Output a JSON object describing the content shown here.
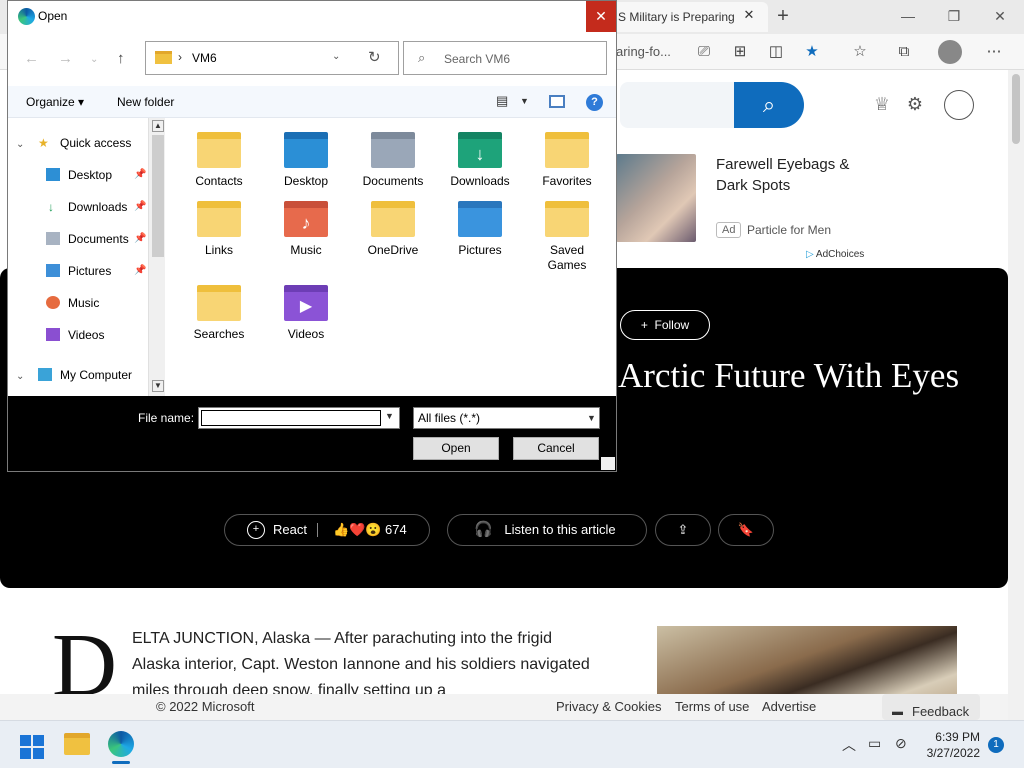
{
  "browser": {
    "tab_title": "S Military is Preparing",
    "tab_close": "✕",
    "new_tab": "+",
    "url": "aring-fo...",
    "controls": {
      "minimize": "—",
      "maximize": "❐",
      "close": "✕"
    },
    "toolbar_icons": [
      "read-aloud-icon",
      "apps-icon",
      "split-screen-icon",
      "favorite-star-icon",
      "favorites-icon",
      "collections-icon",
      "profile-icon",
      "more-icon"
    ]
  },
  "page": {
    "ad": {
      "title": "Farewell Eyebags & Dark Spots",
      "badge": "Ad",
      "sponsor": "Particle for Men",
      "adchoices": "AdChoices"
    },
    "hero": {
      "follow": "Follow",
      "headline": "Arctic Future With Eyes"
    },
    "actions": {
      "react": "React",
      "reaction_emoji": "👍❤️😮",
      "reaction_count": "674",
      "listen": "Listen to this article"
    },
    "article": {
      "dropcap": "D",
      "text": "ELTA JUNCTION, Alaska — After parachuting into the frigid Alaska interior, Capt. Weston Iannone and his soldiers navigated miles through deep snow, finally setting up a"
    },
    "footer": {
      "copyright": "© 2022 Microsoft",
      "privacy": "Privacy & Cookies",
      "terms": "Terms of use",
      "advertise": "Advertise",
      "feedback": "Feedback"
    }
  },
  "taskbar": {
    "time": "6:39 PM",
    "date": "3/27/2022",
    "notifications": "1"
  },
  "dialog": {
    "title": "Open",
    "close": "✕",
    "breadcrumb": "VM6",
    "search_placeholder": "Search VM6",
    "toolbar": {
      "organize": "Organize ▾",
      "new_folder": "New folder",
      "help": "?"
    },
    "nav": {
      "quick_access": "Quick access",
      "items": [
        "Desktop",
        "Downloads",
        "Documents",
        "Pictures",
        "Music",
        "Videos"
      ],
      "my_computer": "My Computer"
    },
    "files": [
      "Contacts",
      "Desktop",
      "Documents",
      "Downloads",
      "Favorites",
      "Links",
      "Music",
      "OneDrive",
      "Pictures",
      "Saved Games",
      "Searches",
      "Videos"
    ],
    "file_name_label": "File name:",
    "file_name_value": "",
    "file_type": "All files (*.*)",
    "open_button": "Open",
    "cancel_button": "Cancel"
  }
}
